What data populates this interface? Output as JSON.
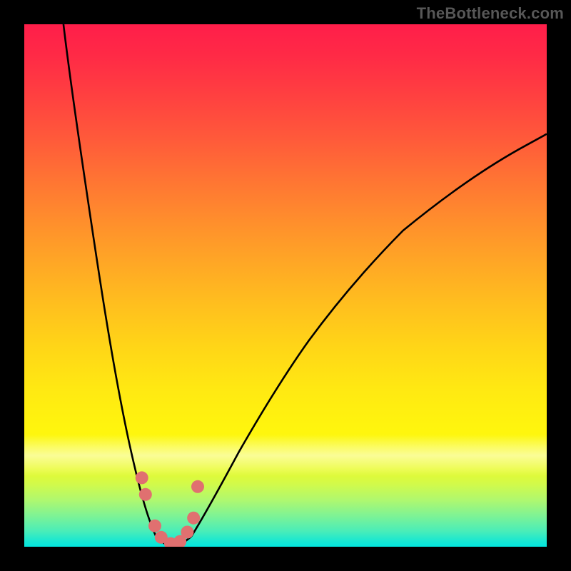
{
  "watermark": "TheBottleneck.com",
  "chart_data": {
    "type": "line",
    "title": "",
    "xlabel": "",
    "ylabel": "",
    "xlim": [
      0,
      1
    ],
    "ylim": [
      0,
      1
    ],
    "grid": false,
    "legend": false,
    "background_gradient": {
      "direction": "vertical",
      "stops": [
        {
          "pos": 0.0,
          "color": "#ff1e4a"
        },
        {
          "pos": 0.3,
          "color": "#ff7533"
        },
        {
          "pos": 0.55,
          "color": "#ffc01e"
        },
        {
          "pos": 0.78,
          "color": "#fff60d"
        },
        {
          "pos": 0.9,
          "color": "#b0f86e"
        },
        {
          "pos": 1.0,
          "color": "#03e5de"
        }
      ]
    },
    "series": [
      {
        "name": "left-arm",
        "stroke": "#000000",
        "x": [
          0.075,
          0.09,
          0.105,
          0.12,
          0.135,
          0.15,
          0.165,
          0.18,
          0.195,
          0.21,
          0.225,
          0.24,
          0.252
        ],
        "y": [
          1.0,
          0.905,
          0.815,
          0.725,
          0.64,
          0.555,
          0.47,
          0.385,
          0.3,
          0.22,
          0.14,
          0.06,
          0.02
        ]
      },
      {
        "name": "right-arm",
        "stroke": "#000000",
        "x": [
          0.32,
          0.345,
          0.375,
          0.41,
          0.45,
          0.495,
          0.545,
          0.6,
          0.66,
          0.725,
          0.8,
          0.88,
          0.96,
          1.0
        ],
        "y": [
          0.02,
          0.06,
          0.115,
          0.18,
          0.25,
          0.325,
          0.4,
          0.47,
          0.54,
          0.605,
          0.665,
          0.72,
          0.768,
          0.79
        ]
      },
      {
        "name": "trough",
        "stroke": "#000000",
        "x": [
          0.252,
          0.26,
          0.27,
          0.285,
          0.3,
          0.312,
          0.32
        ],
        "y": [
          0.02,
          0.01,
          0.004,
          0.0,
          0.004,
          0.01,
          0.02
        ]
      }
    ],
    "markers": {
      "name": "trough-dots",
      "color": "#e07070",
      "radius_px": 9,
      "points_xy": [
        [
          0.225,
          0.132
        ],
        [
          0.232,
          0.1
        ],
        [
          0.25,
          0.04
        ],
        [
          0.262,
          0.018
        ],
        [
          0.28,
          0.006
        ],
        [
          0.298,
          0.01
        ],
        [
          0.312,
          0.028
        ],
        [
          0.324,
          0.055
        ],
        [
          0.332,
          0.115
        ]
      ]
    },
    "notes": "Values are normalized to plot-area fractions. y=0 is the bottom edge (green), y=1 is the top edge (red). The curve forms a sharp V with minimum near x≈0.285; salmon dots cluster along the trough near the minimum."
  }
}
